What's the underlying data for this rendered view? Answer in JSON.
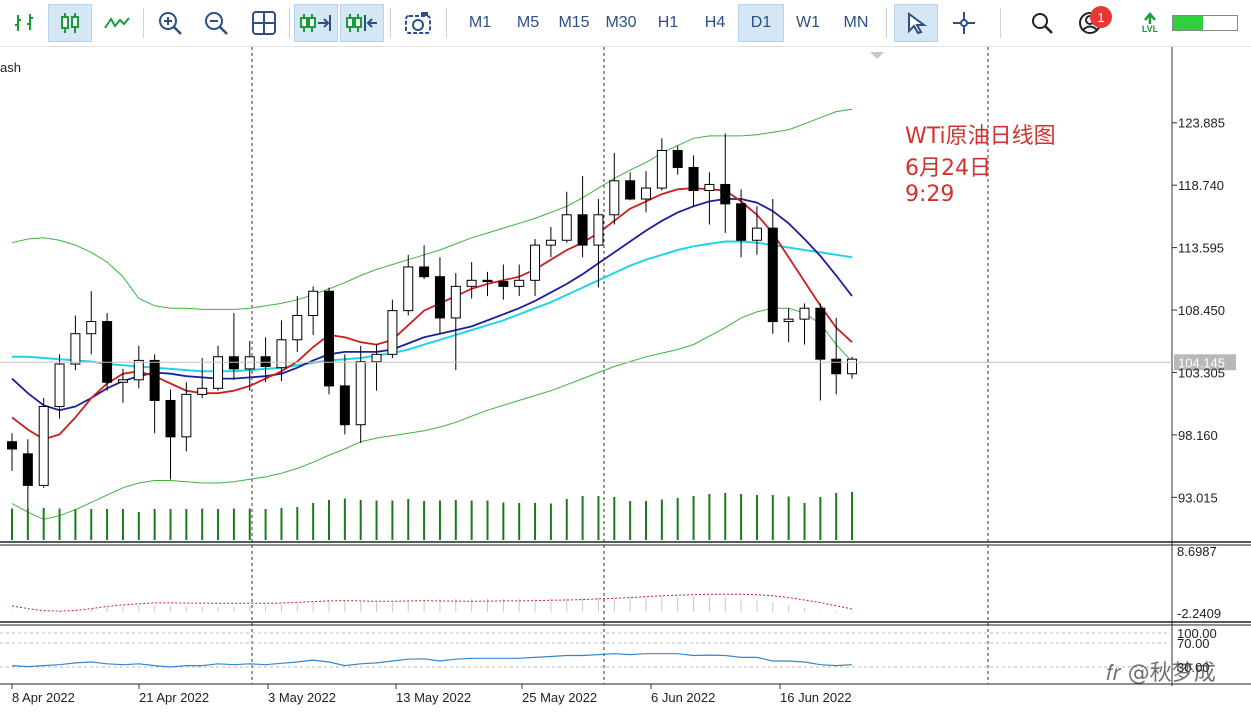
{
  "toolbar": {
    "timeframes": [
      "M1",
      "M5",
      "M15",
      "M30",
      "H1",
      "H4",
      "D1",
      "W1",
      "MN"
    ],
    "active_timeframe": "D1",
    "notifications_count": "1",
    "lvl_label": "LVL"
  },
  "chart": {
    "symbol_partial": "ash",
    "current_price": "104.145",
    "price_ticks": [
      "123.885",
      "118.740",
      "113.595",
      "108.450",
      "103.305",
      "98.160",
      "93.015"
    ],
    "indicator1_ticks": [
      "8.6987",
      "-2.2409"
    ],
    "indicator2_ticks": [
      "100.00",
      "70.00",
      "30.00"
    ],
    "date_labels": [
      "8 Apr 2022",
      "21 Apr 2022",
      "3 May 2022",
      "13 May 2022",
      "25 May 2022",
      "6 Jun 2022",
      "16 Jun 2022"
    ],
    "annotation": [
      "WTi原油日线图",
      "6月24日",
      "9:29"
    ],
    "colors": {
      "ma_fast": "#cc1f1f",
      "ma_mid": "#1a1f9c",
      "ma_slow": "#22d3e6",
      "bollinger": "#3bb33b",
      "volume": "#1a7a1a",
      "rsi": "#3a86c8"
    }
  },
  "chart_data": {
    "type": "candlestick",
    "ylim": [
      89.5,
      126.5
    ],
    "candles": [
      [
        97.6,
        98.3,
        95.2,
        97.0
      ],
      [
        96.6,
        97.8,
        92.0,
        94.0
      ],
      [
        94.0,
        101.2,
        93.8,
        100.5
      ],
      [
        100.5,
        104.8,
        99.5,
        104.0
      ],
      [
        104.0,
        108.0,
        103.5,
        106.5
      ],
      [
        106.5,
        110.0,
        104.8,
        107.5
      ],
      [
        107.5,
        108.2,
        101.8,
        102.5
      ],
      [
        102.5,
        103.6,
        100.8,
        102.7
      ],
      [
        102.7,
        105.5,
        102.0,
        104.3
      ],
      [
        104.3,
        104.8,
        98.3,
        101.0
      ],
      [
        101.0,
        101.9,
        94.5,
        98.0
      ],
      [
        98.0,
        102.5,
        96.8,
        101.5
      ],
      [
        101.5,
        104.5,
        101.2,
        102.0
      ],
      [
        102.0,
        105.5,
        101.8,
        104.6
      ],
      [
        104.6,
        108.2,
        102.7,
        103.6
      ],
      [
        103.6,
        105.9,
        101.8,
        104.6
      ],
      [
        104.6,
        106.2,
        102.5,
        103.8
      ],
      [
        103.7,
        107.6,
        102.6,
        106.0
      ],
      [
        106.0,
        109.6,
        105.0,
        108.0
      ],
      [
        108.0,
        110.4,
        106.4,
        110.0
      ],
      [
        110.0,
        110.3,
        101.5,
        102.2
      ],
      [
        102.2,
        104.8,
        98.2,
        99.0
      ],
      [
        99.0,
        105.5,
        97.5,
        104.2
      ],
      [
        104.2,
        105.6,
        101.8,
        104.8
      ],
      [
        104.8,
        109.3,
        104.5,
        108.4
      ],
      [
        108.4,
        113.0,
        108.0,
        112.0
      ],
      [
        112.0,
        113.8,
        111.0,
        111.2
      ],
      [
        111.2,
        112.8,
        106.5,
        107.8
      ],
      [
        107.8,
        111.5,
        103.5,
        110.4
      ],
      [
        110.4,
        112.4,
        109.4,
        110.9
      ],
      [
        110.9,
        111.6,
        109.6,
        110.8
      ],
      [
        110.8,
        112.2,
        109.3,
        110.4
      ],
      [
        110.4,
        112.2,
        109.6,
        110.9
      ],
      [
        110.9,
        114.3,
        109.6,
        113.8
      ],
      [
        113.8,
        115.3,
        112.8,
        114.2
      ],
      [
        114.2,
        118.2,
        114.0,
        116.3
      ],
      [
        116.3,
        119.5,
        112.8,
        113.8
      ],
      [
        113.8,
        117.6,
        110.3,
        116.3
      ],
      [
        116.3,
        121.4,
        115.5,
        119.1
      ],
      [
        119.1,
        119.8,
        117.5,
        117.6
      ],
      [
        117.6,
        119.9,
        116.5,
        118.5
      ],
      [
        118.5,
        122.6,
        118.3,
        121.6
      ],
      [
        121.6,
        122.0,
        119.6,
        120.2
      ],
      [
        120.2,
        121.2,
        117.0,
        118.3
      ],
      [
        118.3,
        119.8,
        115.5,
        118.8
      ],
      [
        118.8,
        123.0,
        114.8,
        117.2
      ],
      [
        117.2,
        118.4,
        112.8,
        114.2
      ],
      [
        114.2,
        117.0,
        113.0,
        115.2
      ],
      [
        115.2,
        117.6,
        106.5,
        107.5
      ],
      [
        107.5,
        108.6,
        105.8,
        107.7
      ],
      [
        107.7,
        109.0,
        105.6,
        108.6
      ],
      [
        108.6,
        109.0,
        101.0,
        104.4
      ],
      [
        104.4,
        107.8,
        101.5,
        103.2
      ],
      [
        103.2,
        104.6,
        102.8,
        104.4
      ]
    ],
    "ma_fast": [
      99.6,
      98.6,
      97.8,
      98.2,
      99.6,
      101.2,
      102.4,
      103.2,
      103.4,
      103.0,
      102.4,
      101.8,
      101.6,
      101.6,
      101.8,
      102.2,
      102.8,
      103.4,
      104.2,
      105.4,
      106.4,
      106.2,
      105.8,
      105.6,
      106.0,
      107.2,
      108.4,
      109.0,
      109.6,
      110.2,
      110.6,
      110.9,
      111.2,
      111.8,
      112.6,
      113.4,
      114.0,
      114.8,
      115.8,
      116.8,
      117.4,
      118.0,
      118.4,
      118.5,
      118.4,
      118.3,
      117.4,
      116.3,
      114.8,
      112.8,
      110.8,
      108.8,
      107.0,
      105.8
    ],
    "ma_mid": [
      102.8,
      101.6,
      100.6,
      100.2,
      100.5,
      101.2,
      102.0,
      102.6,
      103.0,
      103.3,
      103.2,
      103.0,
      102.9,
      102.8,
      102.8,
      102.9,
      103.0,
      103.2,
      103.7,
      104.3,
      104.8,
      105.0,
      105.0,
      105.0,
      105.2,
      105.7,
      106.2,
      106.5,
      106.8,
      107.1,
      107.6,
      108.1,
      108.6,
      109.2,
      109.9,
      110.6,
      111.4,
      112.3,
      113.2,
      114.1,
      115.0,
      115.8,
      116.5,
      117.0,
      117.4,
      117.6,
      117.6,
      117.3,
      116.6,
      115.6,
      114.3,
      112.9,
      111.3,
      109.6
    ],
    "ma_slow": [
      104.6,
      104.6,
      104.5,
      104.4,
      104.3,
      104.2,
      104.0,
      103.9,
      103.8,
      103.7,
      103.6,
      103.5,
      103.4,
      103.4,
      103.4,
      103.5,
      103.6,
      103.7,
      103.9,
      104.1,
      104.3,
      104.4,
      104.5,
      104.7,
      104.9,
      105.2,
      105.6,
      106.0,
      106.4,
      106.8,
      107.2,
      107.6,
      108.1,
      108.6,
      109.1,
      109.7,
      110.3,
      110.9,
      111.5,
      112.1,
      112.6,
      113.0,
      113.4,
      113.7,
      113.9,
      114.1,
      114.1,
      114.0,
      113.8,
      113.6,
      113.4,
      113.2,
      113.0,
      112.8
    ],
    "bb_upper": [
      114.0,
      114.3,
      114.4,
      114.2,
      113.8,
      113.2,
      112.4,
      111.2,
      109.4,
      108.8,
      108.6,
      108.6,
      108.5,
      108.5,
      108.5,
      108.6,
      108.8,
      109.0,
      109.3,
      109.7,
      110.2,
      110.7,
      111.3,
      111.8,
      112.2,
      112.6,
      113.0,
      113.4,
      113.9,
      114.4,
      114.8,
      115.2,
      115.6,
      116.0,
      116.5,
      117.0,
      117.7,
      118.5,
      119.3,
      120.0,
      120.6,
      121.4,
      122.0,
      122.6,
      122.8,
      122.8,
      122.8,
      122.9,
      123.1,
      123.3,
      123.8,
      124.3,
      124.8,
      125.0
    ],
    "bb_lower": [
      92.5,
      91.8,
      91.2,
      91.5,
      92.0,
      92.6,
      93.2,
      93.8,
      94.2,
      94.4,
      94.4,
      94.3,
      94.2,
      94.2,
      94.3,
      94.5,
      94.7,
      95.0,
      95.4,
      95.9,
      96.5,
      97.0,
      97.6,
      97.9,
      98.1,
      98.3,
      98.5,
      98.8,
      99.2,
      99.7,
      100.2,
      100.6,
      101.0,
      101.4,
      101.8,
      102.3,
      102.8,
      103.3,
      103.8,
      104.2,
      104.6,
      104.9,
      105.2,
      105.6,
      106.3,
      107.0,
      107.8,
      108.3,
      108.6,
      108.6,
      108.2,
      107.3,
      105.6,
      104.2
    ],
    "volume": [
      0.63,
      0.63,
      0.64,
      0.63,
      0.62,
      0.62,
      0.62,
      0.62,
      0.56,
      0.62,
      0.62,
      0.62,
      0.63,
      0.62,
      0.63,
      0.63,
      0.62,
      0.64,
      0.66,
      0.74,
      0.8,
      0.83,
      0.8,
      0.79,
      0.79,
      0.82,
      0.78,
      0.79,
      0.8,
      0.79,
      0.79,
      0.75,
      0.74,
      0.74,
      0.73,
      0.82,
      0.88,
      0.88,
      0.86,
      0.78,
      0.78,
      0.81,
      0.84,
      0.88,
      0.92,
      0.94,
      0.92,
      0.9,
      0.9,
      0.87,
      0.74,
      0.86,
      0.94,
      0.96
    ],
    "rsi": [
      40,
      38,
      40,
      42,
      46,
      48,
      44,
      42,
      44,
      40,
      37,
      40,
      40,
      44,
      42,
      44,
      42,
      45,
      48,
      52,
      48,
      40,
      44,
      46,
      50,
      54,
      55,
      50,
      54,
      56,
      56,
      56,
      56,
      58,
      60,
      62,
      62,
      64,
      66,
      64,
      66,
      66,
      66,
      62,
      63,
      62,
      58,
      58,
      50,
      50,
      48,
      42,
      40,
      42
    ]
  }
}
